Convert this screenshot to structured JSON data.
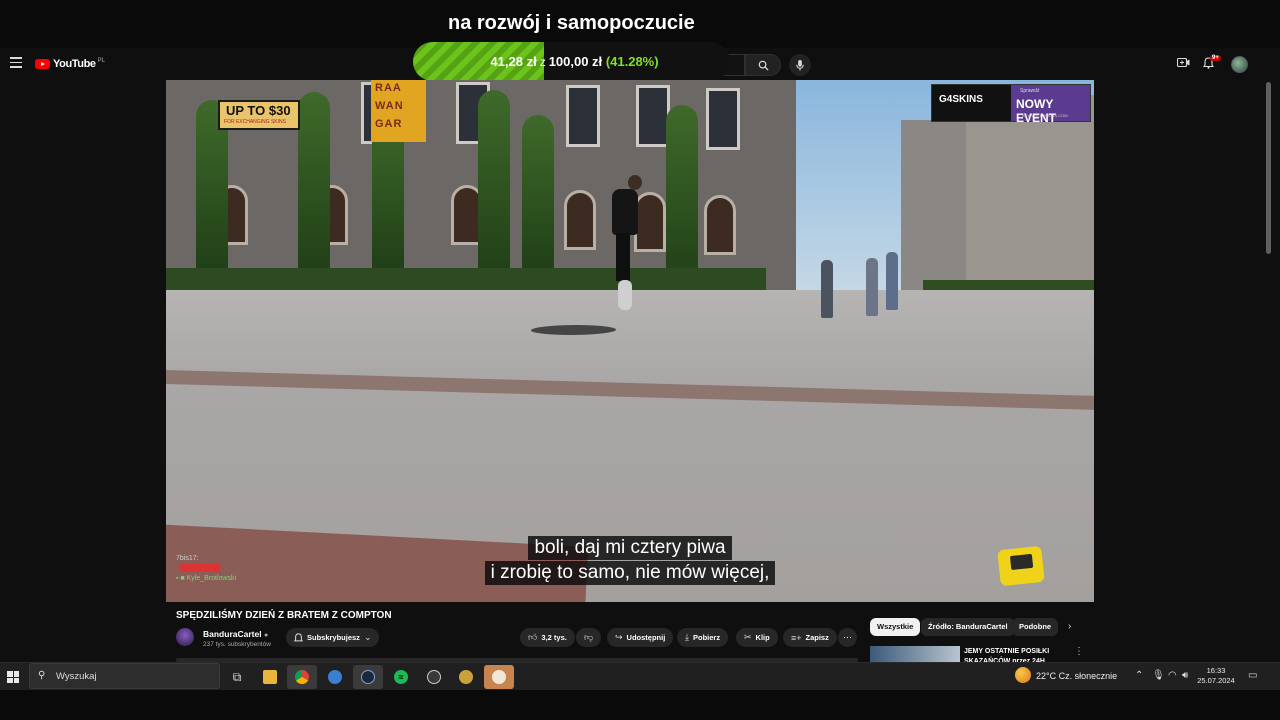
{
  "overlay": {
    "title": "na rozwój i samopoczucie",
    "donation": {
      "current": "41,28 zł",
      "separator": "z",
      "goal": "100,00 zł",
      "percent_label": "(41.28%)",
      "progress": 0.4128
    }
  },
  "header": {
    "logo_text": "YouTube",
    "region": "PL",
    "notifications_badge": "9+"
  },
  "video": {
    "sign_upto": "UP TO $30",
    "sign_upto_small": "FOR EXCHANGING SKINS",
    "banner_letters": [
      "RAA",
      "WAN",
      "GAR"
    ],
    "sponsor": {
      "logo": "G4SKINS",
      "small": "Sprawdź",
      "event": "NOWY EVENT",
      "url": "na WWW.G4SKINS.COM"
    },
    "chat": [
      {
        "user": "7bis17:",
        "color": "#cccccc"
      },
      {
        "user": "▪ ████████ ▪",
        "color": "#dd3333"
      },
      {
        "user": "▪ ■ Kyle_Brotlowski",
        "color": "#7fd17f"
      }
    ],
    "subtitles": [
      "boli, daj mi cztery piwa",
      "i zrobię to samo, nie mów więcej,"
    ]
  },
  "meta": {
    "title": "SPĘDZILIŚMY DZIEŃ Z BRATEM Z COMPTON",
    "channel_name": "BanduraCartel",
    "channel_subs": "237 tys. subskrybentów",
    "subscribe_label": "Subskrybujesz",
    "likes": "3,2 tys.",
    "share_label": "Udostępnij",
    "download_label": "Pobierz",
    "clip_label": "Klip",
    "save_label": "Zapisz",
    "more": "⋯"
  },
  "recommendations": {
    "chips": [
      "Wszystkie",
      "Źródło: BanduraCartel",
      "Podobne"
    ],
    "first_title_1": "JEMY OSTATNIE POSIŁKI",
    "first_title_2": "SKAZAŃCÓW przez 24H"
  },
  "taskbar": {
    "search_placeholder": "Wyszukaj",
    "weather": "22°C  Cz. słonecznie",
    "time": "16:33",
    "date": "25.07.2024"
  },
  "icons": {
    "menu": "menu-icon",
    "search": "search-icon",
    "mic": "mic-icon",
    "create": "create-icon",
    "bell": "bell-icon"
  }
}
